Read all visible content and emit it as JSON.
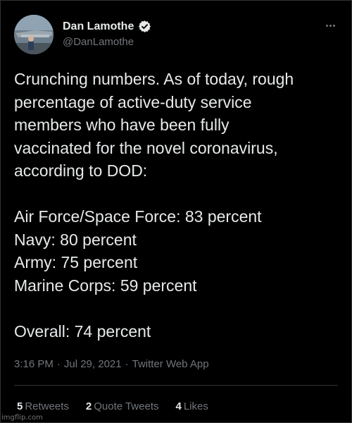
{
  "author": {
    "display_name": "Dan Lamothe",
    "handle": "@DanLamothe",
    "verified": true
  },
  "tweet": {
    "paragraphs": [
      [
        "Crunching numbers. As of today, rough",
        "percentage of active-duty service",
        "members who have been fully",
        "vaccinated for the novel coronavirus,",
        "according to DOD:"
      ],
      [
        "Air Force/Space Force: 83 percent",
        "Navy: 80 percent",
        "Army: 75 percent",
        "Marine Corps: 59 percent"
      ],
      [
        "Overall: 74 percent"
      ]
    ]
  },
  "meta": {
    "time": "3:16 PM",
    "date": "Jul 29, 2021",
    "source": "Twitter Web App",
    "separator": "·"
  },
  "stats": {
    "retweets_count": "5",
    "retweets_label": "Retweets",
    "quote_tweets_count": "2",
    "quote_tweets_label": "Quote Tweets",
    "likes_count": "4",
    "likes_label": "Likes"
  },
  "watermark": "imgflip.com",
  "icons": {
    "more": "more-horizontal-icon",
    "verified": "verified-badge-icon"
  },
  "colors": {
    "background": "#000000",
    "text_primary": "#e7e9ea",
    "text_secondary": "#71767b",
    "divider": "#2f3336",
    "verified_badge": "#e7e9ea"
  }
}
